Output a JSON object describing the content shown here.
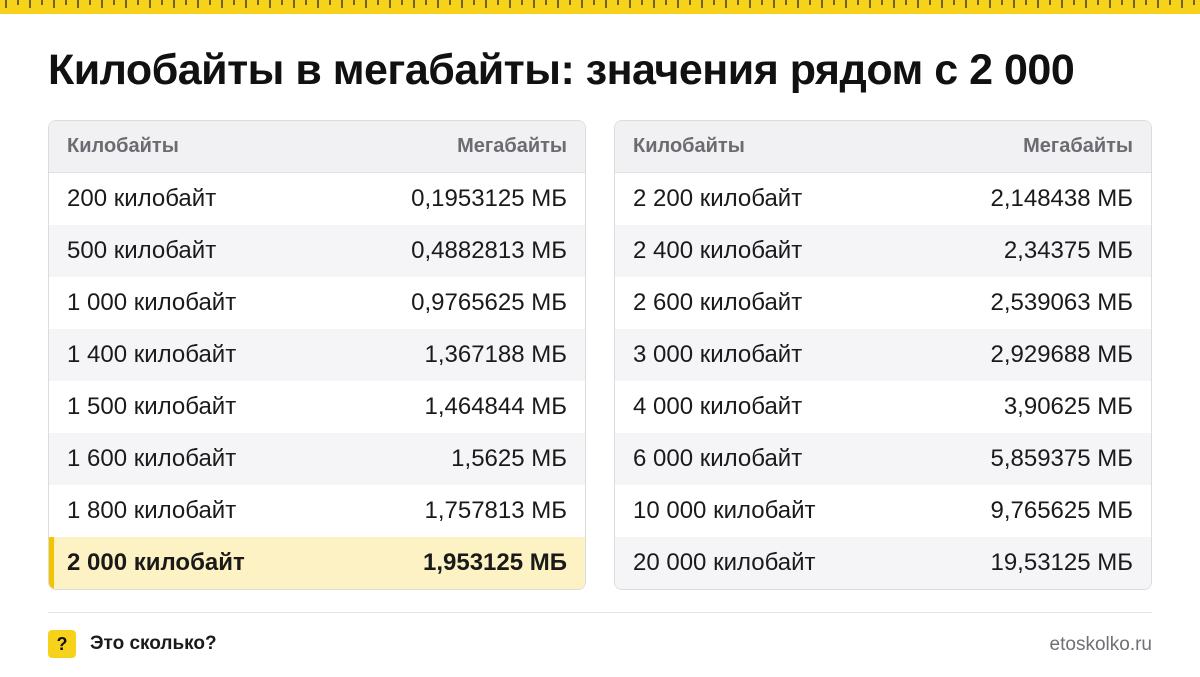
{
  "title": "Килобайты в мегабайты: значения рядом с 2 000",
  "colors": {
    "accent": "#f7d21a",
    "highlight_bg": "#fdf2c3",
    "highlight_bar": "#f2c500"
  },
  "left_table": {
    "col1": "Килобайты",
    "col2": "Мегабайты",
    "rows": [
      {
        "kb": "200 килобайт",
        "mb": "0,1953125 МБ"
      },
      {
        "kb": "500 килобайт",
        "mb": "0,4882813 МБ"
      },
      {
        "kb": "1 000 килобайт",
        "mb": "0,9765625 МБ"
      },
      {
        "kb": "1 400 килобайт",
        "mb": "1,367188 МБ"
      },
      {
        "kb": "1 500 килобайт",
        "mb": "1,464844 МБ"
      },
      {
        "kb": "1 600 килобайт",
        "mb": "1,5625 МБ"
      },
      {
        "kb": "1 800 килобайт",
        "mb": "1,757813 МБ"
      },
      {
        "kb": "2 000 килобайт",
        "mb": "1,953125 МБ"
      }
    ]
  },
  "right_table": {
    "col1": "Килобайты",
    "col2": "Мегабайты",
    "rows": [
      {
        "kb": "2 200 килобайт",
        "mb": "2,148438 МБ"
      },
      {
        "kb": "2 400 килобайт",
        "mb": "2,34375 МБ"
      },
      {
        "kb": "2 600 килобайт",
        "mb": "2,539063 МБ"
      },
      {
        "kb": "3 000 килобайт",
        "mb": "2,929688 МБ"
      },
      {
        "kb": "4 000 килобайт",
        "mb": "3,90625 МБ"
      },
      {
        "kb": "6 000 килобайт",
        "mb": "5,859375 МБ"
      },
      {
        "kb": "10 000 килобайт",
        "mb": "9,765625 МБ"
      },
      {
        "kb": "20 000 килобайт",
        "mb": "19,53125 МБ"
      }
    ]
  },
  "footer": {
    "icon": "question-icon",
    "icon_glyph": "?",
    "brand": "Это сколько?",
    "site": "etoskolko.ru"
  }
}
